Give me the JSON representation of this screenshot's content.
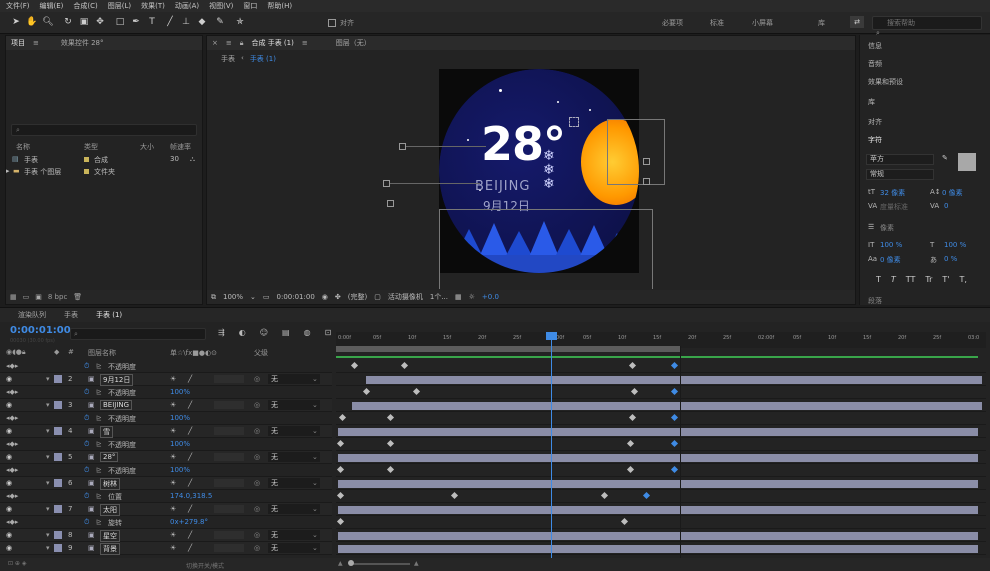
{
  "menubar": [
    "文件(F)",
    "编辑(E)",
    "合成(C)",
    "图层(L)",
    "效果(T)",
    "动画(A)",
    "视图(V)",
    "窗口",
    "帮助(H)"
  ],
  "toolbar": {
    "snap_label": "对齐",
    "workspaces": [
      "必要项",
      "标准",
      "小屏幕",
      "库"
    ],
    "search_placeholder": "搜索帮助"
  },
  "project_panel": {
    "tab": "项目",
    "effect_tab": "效果控件 28°",
    "search_placeholder": "",
    "columns": [
      "名称",
      "类型",
      "大小",
      "帧速率"
    ],
    "items": [
      {
        "name": "手表",
        "type": "合成",
        "fps": "30"
      },
      {
        "name": "手表 个图层",
        "type": "文件夹",
        "fps": ""
      }
    ],
    "bpc": "8 bpc"
  },
  "comp_panel": {
    "tab": "合成 手表 (1)",
    "layer_tab": "图层（无）",
    "breadcrumbs": [
      "手表",
      "手表 (1)"
    ],
    "canvas": {
      "temperature": "28°",
      "city": "BEIJING",
      "date": "9月12日"
    },
    "footer": {
      "zoom": "100%",
      "timecode": "0:00:01:00",
      "quality": "(完整)",
      "camera": "活动摄像机",
      "views": "1个...",
      "exposure": "+0.0"
    }
  },
  "right_panel": {
    "sections": [
      "信息",
      "音频",
      "效果和预设",
      "库",
      "对齐",
      "字符"
    ],
    "character": {
      "font": "苹方",
      "style": "常规",
      "size": "32 像素",
      "leading": "0 像素",
      "tracking_label": "度量标准",
      "tracking": "0",
      "indent": "像素",
      "vscale": "100 %",
      "hscale": "100 %",
      "baseline": "0 像素",
      "tsume": "0 %",
      "format_buttons": [
        "T",
        "T",
        "TT",
        "Tr",
        "T'",
        "T,"
      ]
    },
    "paragraph": "段落"
  },
  "timeline": {
    "tabs": [
      "渲染队列",
      "手表",
      "手表 (1)"
    ],
    "timecode": "0:00:01:00",
    "fps_note": "00030 (30.00 fps)",
    "search_placeholder": "",
    "headers": {
      "num": "#",
      "name": "图层名称",
      "switches": "单☆\\fx■●◐⊙",
      "parent": "父级"
    },
    "rows": [
      {
        "kind": "prop",
        "name": "不透明度",
        "value": ""
      },
      {
        "kind": "layer",
        "num": "2",
        "name": "9月12日",
        "parent": "无"
      },
      {
        "kind": "prop",
        "name": "不透明度",
        "value": "100%"
      },
      {
        "kind": "layer",
        "num": "3",
        "name": "BEIJING",
        "parent": "无"
      },
      {
        "kind": "prop",
        "name": "不透明度",
        "value": "100%"
      },
      {
        "kind": "layer",
        "num": "4",
        "name": "雪",
        "parent": "无"
      },
      {
        "kind": "prop",
        "name": "不透明度",
        "value": "100%"
      },
      {
        "kind": "layer",
        "num": "5",
        "name": "28°",
        "parent": "无"
      },
      {
        "kind": "prop",
        "name": "不透明度",
        "value": "100%"
      },
      {
        "kind": "layer",
        "num": "6",
        "name": "树林",
        "parent": "无"
      },
      {
        "kind": "prop",
        "name": "位置",
        "value": "174.0,318.5"
      },
      {
        "kind": "layer",
        "num": "7",
        "name": "太阳",
        "parent": "无"
      },
      {
        "kind": "prop",
        "name": "旋转",
        "value": "0x+279.8°"
      },
      {
        "kind": "layer",
        "num": "8",
        "name": "星空",
        "parent": "无"
      },
      {
        "kind": "layer",
        "num": "9",
        "name": "背景",
        "parent": "无"
      }
    ],
    "ruler_ticks": [
      "0:00f",
      "05f",
      "10f",
      "15f",
      "20f",
      "25f",
      "01:00f",
      "05f",
      "10f",
      "15f",
      "20f",
      "25f",
      "02:00f",
      "05f",
      "10f",
      "15f",
      "20f",
      "25f",
      "03:0"
    ],
    "bottom_label": "切换开关/模式"
  }
}
